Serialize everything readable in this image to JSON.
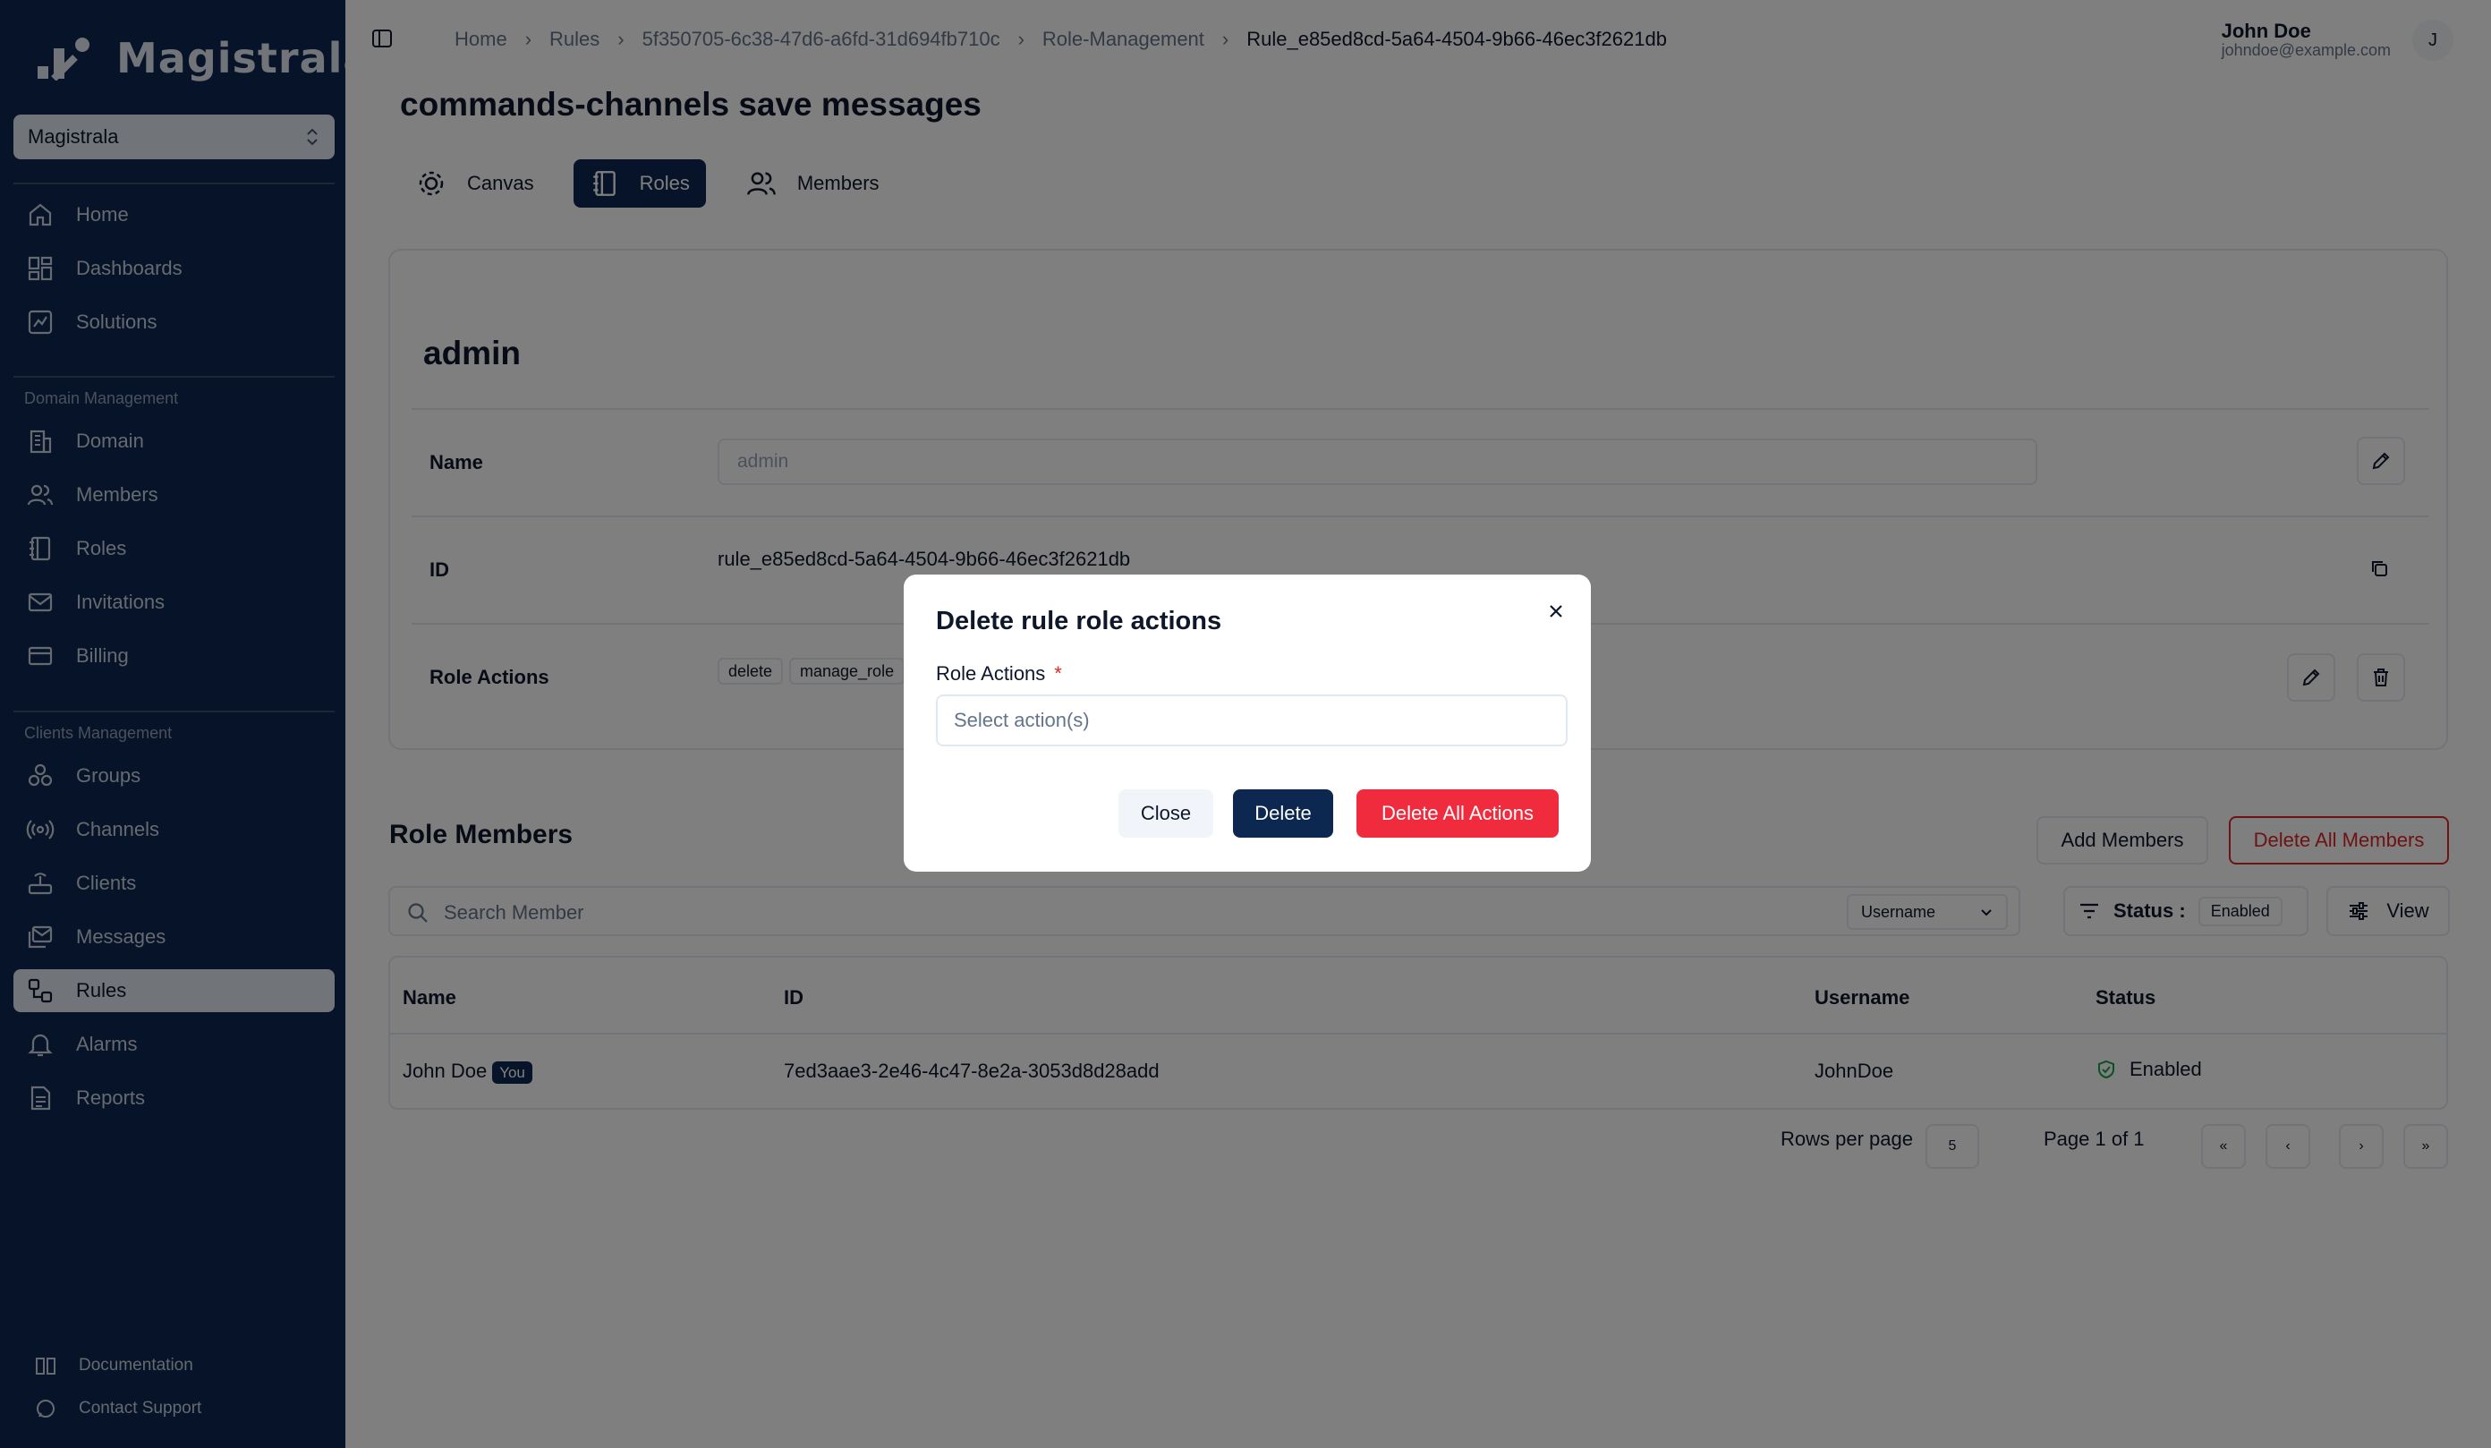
{
  "brand": {
    "name": "Magistrala"
  },
  "workspace": {
    "name": "Magistrala"
  },
  "sidebar": {
    "main": [
      {
        "label": "Home",
        "icon": "home-icon"
      },
      {
        "label": "Dashboards",
        "icon": "dashboard-icon"
      },
      {
        "label": "Solutions",
        "icon": "solutions-icon"
      }
    ],
    "domain_group": "Domain Management",
    "domain": [
      {
        "label": "Domain",
        "icon": "building-icon"
      },
      {
        "label": "Members",
        "icon": "users-icon"
      },
      {
        "label": "Roles",
        "icon": "notebook-icon"
      },
      {
        "label": "Invitations",
        "icon": "mail-icon"
      },
      {
        "label": "Billing",
        "icon": "credit-card-icon"
      }
    ],
    "clients_group": "Clients Management",
    "clients": [
      {
        "label": "Groups",
        "icon": "groups-icon"
      },
      {
        "label": "Channels",
        "icon": "radio-icon"
      },
      {
        "label": "Clients",
        "icon": "router-icon"
      },
      {
        "label": "Messages",
        "icon": "messages-icon"
      },
      {
        "label": "Rules",
        "icon": "rules-icon",
        "active": true
      },
      {
        "label": "Alarms",
        "icon": "bell-icon"
      },
      {
        "label": "Reports",
        "icon": "report-icon"
      }
    ],
    "footer": [
      {
        "label": "Documentation",
        "icon": "book-icon"
      },
      {
        "label": "Contact Support",
        "icon": "chat-icon"
      }
    ]
  },
  "breadcrumbs": [
    "Home",
    "Rules",
    "5f350705-6c38-47d6-a6fd-31d694fb710c",
    "Role-Management",
    "Rule_e85ed8cd-5a64-4504-9b66-46ec3f2621db"
  ],
  "user": {
    "name": "John Doe",
    "email": "johndoe@example.com",
    "initial": "J"
  },
  "page": {
    "title": "commands-channels save messages"
  },
  "tabs": [
    {
      "label": "Canvas",
      "icon": "gear-icon"
    },
    {
      "label": "Roles",
      "icon": "notebook-icon",
      "active": true
    },
    {
      "label": "Members",
      "icon": "users-icon"
    }
  ],
  "role": {
    "heading": "admin",
    "name_label": "Name",
    "name_value": "admin",
    "id_label": "ID",
    "id_value": "rule_e85ed8cd-5a64-4504-9b66-46ec3f2621db",
    "actions_label": "Role Actions",
    "actions": [
      "delete",
      "manage_role"
    ]
  },
  "members": {
    "title": "Role Members",
    "add_label": "Add Members",
    "delete_all_label": "Delete All Members",
    "search_placeholder": "Search Member",
    "search_field": "Username",
    "status_label": "Status :",
    "status_value": "Enabled",
    "view_label": "View",
    "columns": [
      "Name",
      "ID",
      "Username",
      "Status"
    ],
    "rows": [
      {
        "name": "John Doe",
        "badge": "You",
        "id": "7ed3aae3-2e46-4c47-8e2a-3053d8d28add",
        "username": "JohnDoe",
        "status": "Enabled"
      }
    ],
    "rows_per_page_label": "Rows per page",
    "rows_per_page": "5",
    "page_info": "Page 1 of 1"
  },
  "dialog": {
    "title": "Delete rule role actions",
    "field_label": "Role Actions",
    "required_mark": "*",
    "placeholder": "Select action(s)",
    "close_label": "Close",
    "delete_label": "Delete",
    "delete_all_label": "Delete All Actions"
  },
  "colors": {
    "navy": "#0c2750",
    "danger": "#ef2b3d",
    "success": "#16a34a"
  }
}
